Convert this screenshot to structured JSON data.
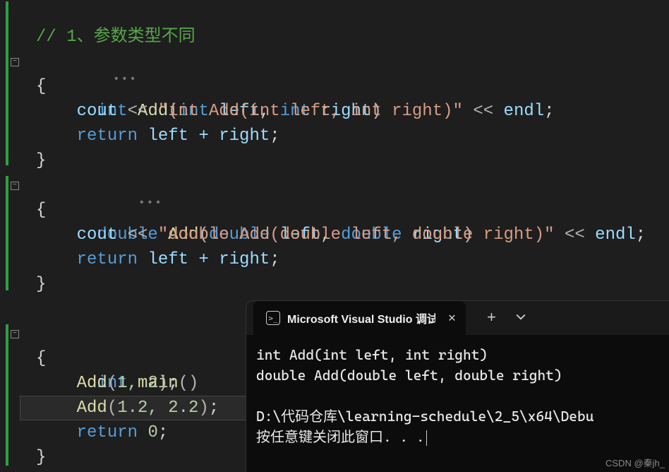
{
  "code": {
    "comment": "// 1、参数类型不同",
    "fn1": {
      "ret": "int",
      "name": "Add",
      "params_kw1": "int",
      "params_var1": "left",
      "comma": ",",
      "params_kw2": "int",
      "params_var2": "right",
      "cout": "cout",
      "ops": "<<",
      "str": "\"int Add(int left, int right)\"",
      "endl": "endl",
      "semi": ";",
      "ret_kw": "return",
      "expr": "left + right"
    },
    "fn2": {
      "ret": "double",
      "name": "Add",
      "params_kw1": "double",
      "params_var1": "left",
      "comma": ",",
      "params_kw2": "double",
      "params_var2": "right",
      "cout": "cout",
      "ops": "<<",
      "str": "\"double Add(double left, double right)\"",
      "endl": "endl",
      "semi": ";",
      "ret_kw": "return",
      "expr": "left + right"
    },
    "main": {
      "ret": "int",
      "name": "main",
      "call1_fn": "Add",
      "call1_args": "1, 2",
      "call2_fn": "Add",
      "call2_args": "1.2, 2.2",
      "ret_kw": "return",
      "ret_val": "0"
    },
    "brace_open": "{",
    "brace_close": "}"
  },
  "terminal": {
    "tab_title": "Microsoft Visual Studio 调试",
    "output_line1": "int Add(int left, int right)",
    "output_line2": "double Add(double left, double right)",
    "output_line3": "",
    "output_line4": "D:\\代码仓库\\learning-schedule\\2_5\\x64\\Debu",
    "output_line5": "按任意键关闭此窗口. . ."
  },
  "watermark": "CSDN @秦jh_"
}
